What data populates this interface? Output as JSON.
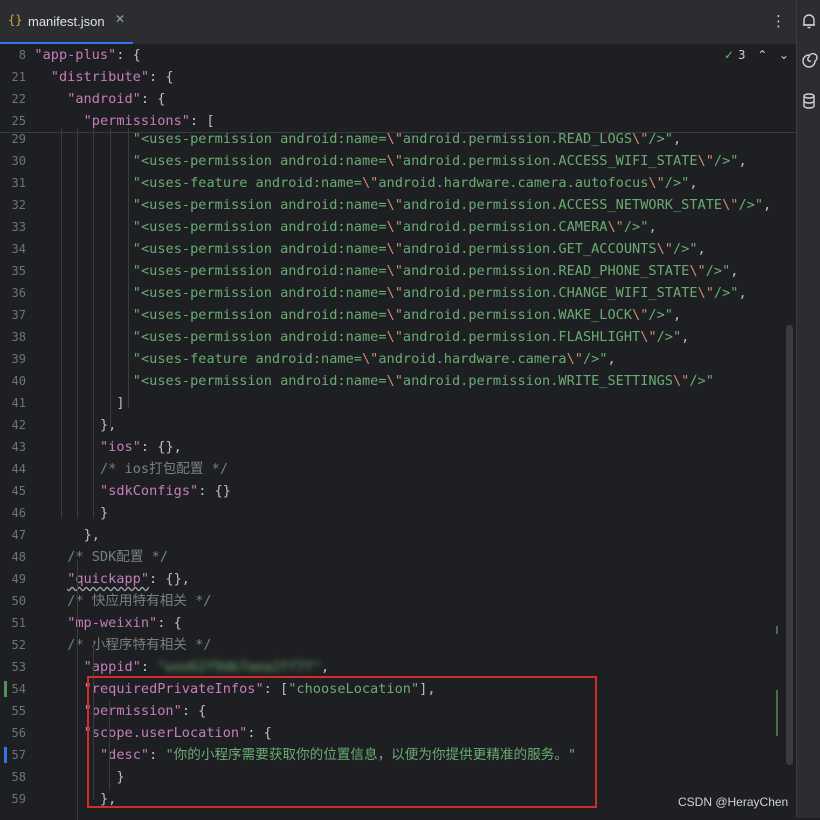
{
  "tab": {
    "icon": "{}",
    "label": "manifest.json",
    "close_glyph": "✕"
  },
  "menu_glyph": "⋮",
  "inspection": {
    "check_glyph": "✓",
    "count": "3",
    "up_glyph": "⌃",
    "down_glyph": "⌄"
  },
  "right_strip": {
    "icons": [
      "notifications-icon",
      "ai-assistant-icon",
      "database-icon"
    ]
  },
  "sticky_lines": [
    {
      "num": "8",
      "indent": 6,
      "html": "<span class='tok-key'>\"app-plus\"</span><span class='tok-punc'>: {</span>"
    },
    {
      "num": "21",
      "indent": 8,
      "html": "<span class='tok-key'>\"distribute\"</span><span class='tok-punc'>: {</span>"
    },
    {
      "num": "22",
      "indent": 10,
      "html": "<span class='tok-key'>\"android\"</span><span class='tok-punc'>: {</span>"
    },
    {
      "num": "25",
      "indent": 12,
      "html": "<span class='tok-key'>\"permissions\"</span><span class='tok-punc'>: [</span>"
    }
  ],
  "code_lines": [
    {
      "num": "29",
      "html": "<span class='tok-str'>\"&lt;uses-permission android:name=<span class='tok-escape'>\\\"</span>android.permission.READ_LOGS<span class='tok-escape'>\\\"</span>/&gt;\"</span><span class='tok-punc'>,</span>"
    },
    {
      "num": "30",
      "html": "<span class='tok-str'>\"&lt;uses-permission android:name=<span class='tok-escape'>\\\"</span>android.permission.ACCESS_WIFI_STATE<span class='tok-escape'>\\\"</span>/&gt;\"</span><span class='tok-punc'>,</span>"
    },
    {
      "num": "31",
      "html": "<span class='tok-str'>\"&lt;uses-feature android:name=<span class='tok-escape'>\\\"</span>android.hardware.camera.autofocus<span class='tok-escape'>\\\"</span>/&gt;\"</span><span class='tok-punc'>,</span>"
    },
    {
      "num": "32",
      "html": "<span class='tok-str'>\"&lt;uses-permission android:name=<span class='tok-escape'>\\\"</span>android.permission.ACCESS_NETWORK_STATE<span class='tok-escape'>\\\"</span>/&gt;\"</span><span class='tok-punc'>,</span>"
    },
    {
      "num": "33",
      "html": "<span class='tok-str'>\"&lt;uses-permission android:name=<span class='tok-escape'>\\\"</span>android.permission.CAMERA<span class='tok-escape'>\\\"</span>/&gt;\"</span><span class='tok-punc'>,</span>"
    },
    {
      "num": "34",
      "html": "<span class='tok-str'>\"&lt;uses-permission android:name=<span class='tok-escape'>\\\"</span>android.permission.GET_ACCOUNTS<span class='tok-escape'>\\\"</span>/&gt;\"</span><span class='tok-punc'>,</span>"
    },
    {
      "num": "35",
      "html": "<span class='tok-str'>\"&lt;uses-permission android:name=<span class='tok-escape'>\\\"</span>android.permission.READ_PHONE_STATE<span class='tok-escape'>\\\"</span>/&gt;\"</span><span class='tok-punc'>,</span>"
    },
    {
      "num": "36",
      "html": "<span class='tok-str'>\"&lt;uses-permission android:name=<span class='tok-escape'>\\\"</span>android.permission.CHANGE_WIFI_STATE<span class='tok-escape'>\\\"</span>/&gt;\"</span><span class='tok-punc'>,</span>"
    },
    {
      "num": "37",
      "html": "<span class='tok-str'>\"&lt;uses-permission android:name=<span class='tok-escape'>\\\"</span>android.permission.WAKE_LOCK<span class='tok-escape'>\\\"</span>/&gt;\"</span><span class='tok-punc'>,</span>"
    },
    {
      "num": "38",
      "html": "<span class='tok-str'>\"&lt;uses-permission android:name=<span class='tok-escape'>\\\"</span>android.permission.FLASHLIGHT<span class='tok-escape'>\\\"</span>/&gt;\"</span><span class='tok-punc'>,</span>"
    },
    {
      "num": "39",
      "html": "<span class='tok-str'>\"&lt;uses-feature android:name=<span class='tok-escape'>\\\"</span>android.hardware.camera<span class='tok-escape'>\\\"</span>/&gt;\"</span><span class='tok-punc'>,</span>"
    },
    {
      "num": "40",
      "html": "<span class='tok-str'>\"&lt;uses-permission android:name=<span class='tok-escape'>\\\"</span>android.permission.WRITE_SETTINGS<span class='tok-escape'>\\\"</span>/&gt;\"</span>"
    },
    {
      "num": "41",
      "html": "<span class='tok-punc'>]</span>"
    },
    {
      "num": "42",
      "html": "<span class='tok-punc'>},</span>"
    },
    {
      "num": "43",
      "html": "<span class='tok-key'>\"ios\"</span><span class='tok-punc'>: {},</span>"
    },
    {
      "num": "44",
      "html": "<span class='tok-comment'>/* ios打包配置 */</span>"
    },
    {
      "num": "45",
      "html": "<span class='tok-key'>\"sdkConfigs\"</span><span class='tok-punc'>: {}</span>"
    },
    {
      "num": "46",
      "html": "<span class='tok-punc'>}</span>"
    },
    {
      "num": "47",
      "html": "<span class='tok-punc'>},</span>"
    },
    {
      "num": "48",
      "html": "<span class='tok-comment'>/* SDK配置 */</span>"
    },
    {
      "num": "49",
      "html": "<span class='tok-key squiggle'>\"quickapp\"</span><span class='tok-punc'>: {},</span>"
    },
    {
      "num": "50",
      "html": "<span class='tok-comment'>/* 快应用特有相关 */</span>"
    },
    {
      "num": "51",
      "html": "<span class='tok-key'>\"mp-weixin\"</span><span class='tok-punc'>: {</span>"
    },
    {
      "num": "52",
      "html": "<span class='tok-comment'>/* 小程序特有相关 */</span>"
    },
    {
      "num": "53",
      "html": "<span class='tok-key'>\"appid\"</span><span class='tok-punc'>: </span><span class='tok-blur'>\"wxe62f9db7aea2ff7f\"</span><span class='tok-punc'>,</span>"
    },
    {
      "num": "54",
      "html": "<span class='tok-key'>\"requiredPrivateInfos\"</span><span class='tok-punc'>: [</span><span class='tok-str'>\"chooseLocation\"</span><span class='tok-punc'>],</span>"
    },
    {
      "num": "55",
      "html": "<span class='tok-key'>\"permission\"</span><span class='tok-punc'>: {</span>"
    },
    {
      "num": "56",
      "html": "<span class='tok-key'>\"scope.userLocation\"</span><span class='tok-punc'>: {</span>"
    },
    {
      "num": "57",
      "html": "<span class='tok-key'>\"desc\"</span><span class='tok-punc'>: </span><span class='tok-str'>\"你的小程序需要获取你的位置信息，以便为你提供更精准的服务。\"</span>"
    },
    {
      "num": "58",
      "html": "<span class='tok-punc'>}</span>"
    },
    {
      "num": "59",
      "html": "<span class='tok-punc'>},</span>"
    }
  ],
  "watermark": "CSDN @HerayChen",
  "colors": {
    "background": "#1e1f22",
    "key": "#c77dbb",
    "string": "#6aab73",
    "comment": "#7a7e85",
    "highlight_box": "#d22c2c",
    "accent": "#3574f0"
  }
}
